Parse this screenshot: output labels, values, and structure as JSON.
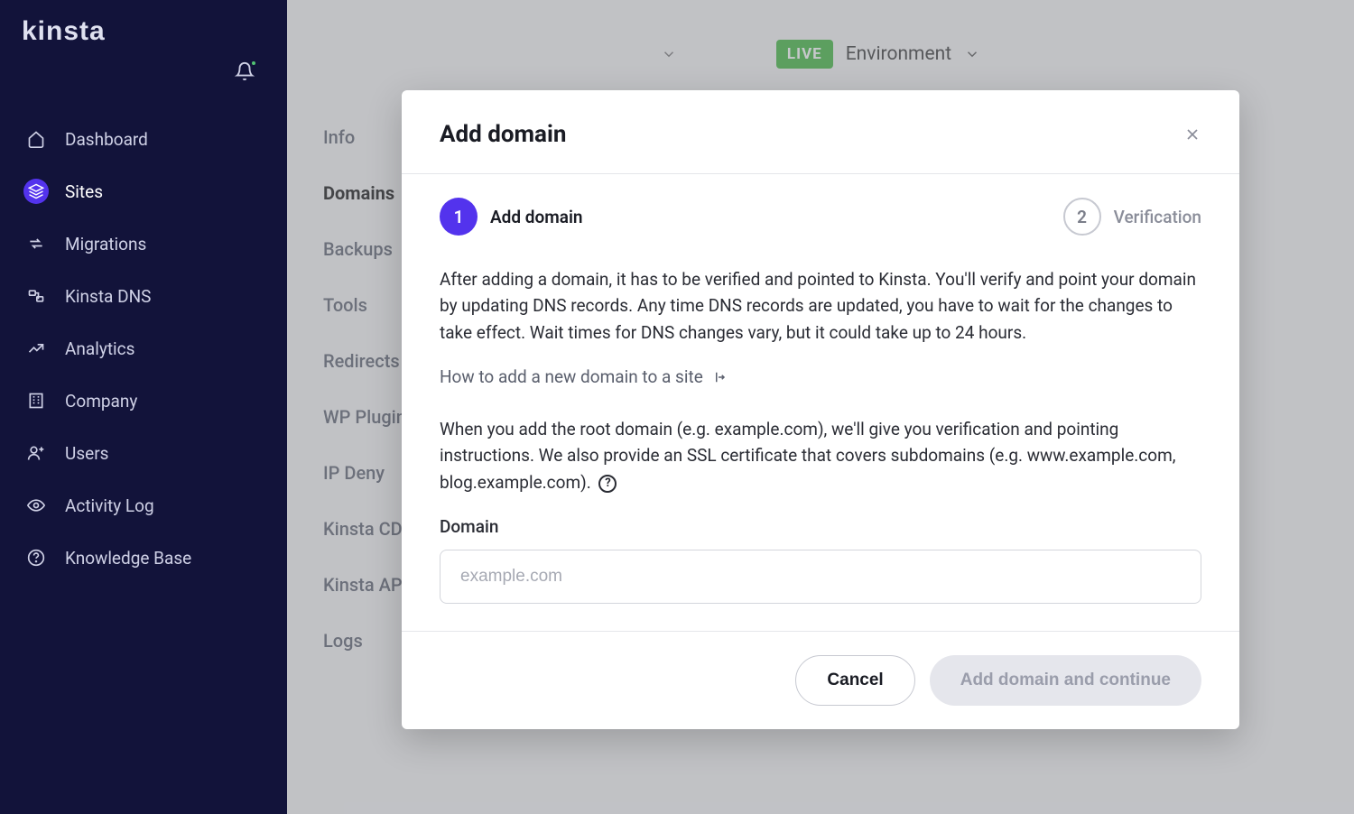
{
  "brand": "Kinsta",
  "sidebar": {
    "items": [
      {
        "label": "Dashboard",
        "icon": "home"
      },
      {
        "label": "Sites",
        "icon": "layers",
        "active": true
      },
      {
        "label": "Migrations",
        "icon": "arrows"
      },
      {
        "label": "Kinsta DNS",
        "icon": "dns"
      },
      {
        "label": "Analytics",
        "icon": "chart"
      },
      {
        "label": "Company",
        "icon": "building"
      },
      {
        "label": "Users",
        "icon": "user-plus"
      },
      {
        "label": "Activity Log",
        "icon": "eye"
      },
      {
        "label": "Knowledge Base",
        "icon": "question"
      }
    ]
  },
  "topbar": {
    "live_badge": "LIVE",
    "env_label": "Environment"
  },
  "subnav": {
    "items": [
      {
        "label": "Info"
      },
      {
        "label": "Domains",
        "active": true
      },
      {
        "label": "Backups"
      },
      {
        "label": "Tools"
      },
      {
        "label": "Redirects"
      },
      {
        "label": "WP Plugins"
      },
      {
        "label": "IP Deny"
      },
      {
        "label": "Kinsta CDN"
      },
      {
        "label": "Kinsta APM"
      },
      {
        "label": "Logs"
      }
    ]
  },
  "modal": {
    "title": "Add domain",
    "steps": {
      "one_num": "1",
      "one_label": "Add domain",
      "two_num": "2",
      "two_label": "Verification"
    },
    "info1": "After adding a domain, it has to be verified and pointed to Kinsta. You'll verify and point your domain by updating DNS records. Any time DNS records are updated, you have to wait for the changes to take effect. Wait times for DNS changes vary, but it could take up to 24 hours.",
    "help_link": "How to add a new domain to a site",
    "info2": "When you add the root domain (e.g. example.com), we'll give you verification and pointing instructions. We also provide an SSL certificate that covers subdomains (e.g. www.example.com, blog.example.com).",
    "domain_label": "Domain",
    "domain_placeholder": "example.com",
    "cancel": "Cancel",
    "submit": "Add domain and continue"
  }
}
